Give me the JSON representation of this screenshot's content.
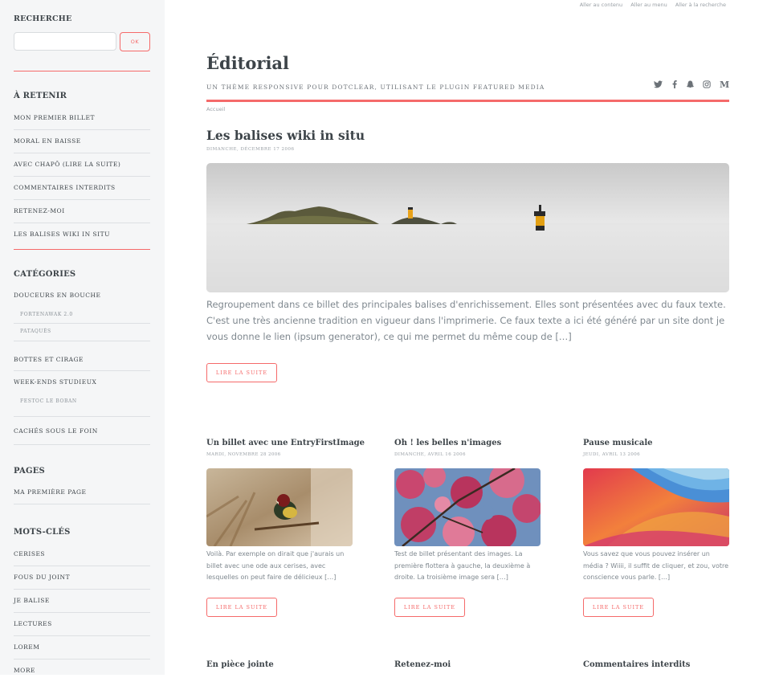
{
  "sidebar": {
    "search": {
      "title": "RECHERCHE",
      "placeholder": "",
      "button": "OK"
    },
    "retenir": {
      "title": "À RETENIR",
      "items": [
        "MON PREMIER BILLET",
        "MORAL EN BAISSE",
        "AVEC CHAPÔ (LIRE LA SUITE)",
        "COMMENTAIRES INTERDITS",
        "RETENEZ-MOI",
        "LES BALISES WIKI IN SITU"
      ]
    },
    "categories": {
      "title": "CATÉGORIES",
      "items": [
        {
          "label": "DOUCEURS EN BOUCHE",
          "children": [
            "FORTENAWAK 2.0",
            "PATAQUÈS"
          ]
        },
        {
          "label": "BOTTES ET CIRAGE",
          "children": []
        },
        {
          "label": "WEEK-ENDS STUDIEUX",
          "children": [
            "FESTOC LE BOBAN"
          ]
        },
        {
          "label": "CACHÉS SOUS LE FOIN",
          "children": []
        }
      ]
    },
    "pages": {
      "title": "PAGES",
      "items": [
        "MA PREMIÈRE PAGE"
      ]
    },
    "tags": {
      "title": "MOTS-CLÉS",
      "items": [
        "CERISES",
        "FOUS DU JOINT",
        "JE BALISE",
        "LECTURES",
        "LOREM",
        "MORE"
      ]
    }
  },
  "header": {
    "skip_links": [
      "Aller au contenu",
      "Aller au menu",
      "Aller à la recherche"
    ],
    "title": "Éditorial",
    "tagline": "UN THÈME RESPONSIVE POUR DOTCLEAR, UTILISANT LE PLUGIN FEATURED MEDIA",
    "socials": [
      "twitter-icon",
      "facebook-icon",
      "snapchat-icon",
      "instagram-icon",
      "medium-icon"
    ],
    "breadcrumb": "Accueil"
  },
  "featured": {
    "title": "Les balises wiki in situ",
    "date": "DIMANCHE, DÉCEMBRE 17 2006",
    "excerpt": "Regroupement dans ce billet des principales balises d'enrichissement. Elles sont présentées avec du faux texte. C'est une très ancienne tradition en vigueur dans l'imprimerie. Ce faux texte a ici été généré par un site dont je vous donne le lien (ipsum generator), ce qui me permet du même coup de […]",
    "button": "LIRE LA SUITE"
  },
  "posts": [
    {
      "title": "Un billet avec une EntryFirstImage",
      "date": "MARDI, NOVEMBRE 28 2006",
      "excerpt": "Voilà. Par exemple on dirait que j'aurais un billet avec une ode aux cerises, avec lesquelles on peut faire de délicieux […]",
      "button": "LIRE LA SUITE"
    },
    {
      "title": "Oh ! les belles n'images",
      "date": "DIMANCHE, AVRIL 16 2006",
      "excerpt": "Test de billet présentant des images. La première flottera à gauche, la deuxième à droite. La troisième image sera […]",
      "button": "LIRE LA SUITE"
    },
    {
      "title": "Pause musicale",
      "date": "JEUDI, AVRIL 13 2006",
      "excerpt": "Vous savez que vous pouvez insérer un média ? Wiiii, il suffit de cliquer, et zou, votre conscience vous parle.  […]",
      "button": "LIRE LA SUITE"
    }
  ],
  "next_row": [
    "En pièce jointe",
    "Retenez-moi",
    "Commentaires interdits"
  ],
  "colors": {
    "accent": "#f56a6a",
    "sidebar_bg": "#f5f6f7",
    "text": "#3d4449"
  }
}
